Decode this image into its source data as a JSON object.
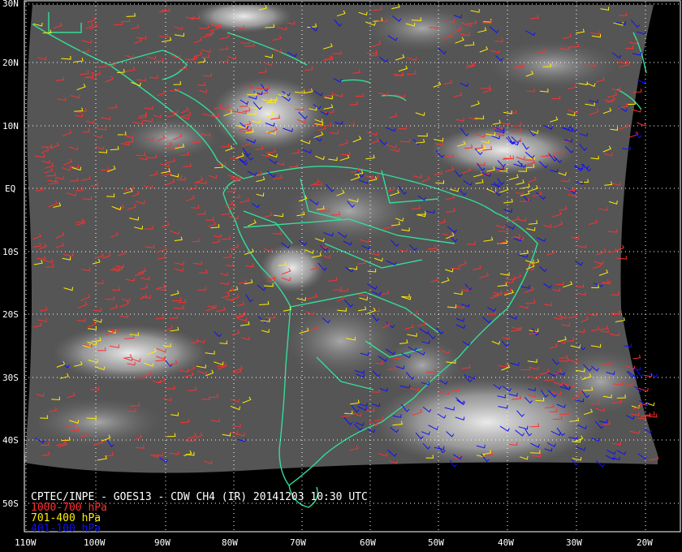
{
  "title": "CPTEC/INPE - GOES13 - CDW CH4 (IR) 20141203 10:30 UTC",
  "legend": [
    {
      "label": "1000-700 hPa",
      "color": "#ff3030"
    },
    {
      "label": "701-400 hPa",
      "color": "#ffee00"
    },
    {
      "label": "401-100 hPa",
      "color": "#1010ff"
    }
  ],
  "colors": {
    "coastline": "#33dd99",
    "grid": "#ffffff",
    "background": "#000000"
  },
  "lat_labels": [
    "30N",
    "20N",
    "10N",
    "EQ",
    "10S",
    "20S",
    "30S",
    "40S",
    "50S"
  ],
  "lon_labels": [
    "110W",
    "100W",
    "90W",
    "80W",
    "70W",
    "60W",
    "50W",
    "40W",
    "30W",
    "20W"
  ]
}
